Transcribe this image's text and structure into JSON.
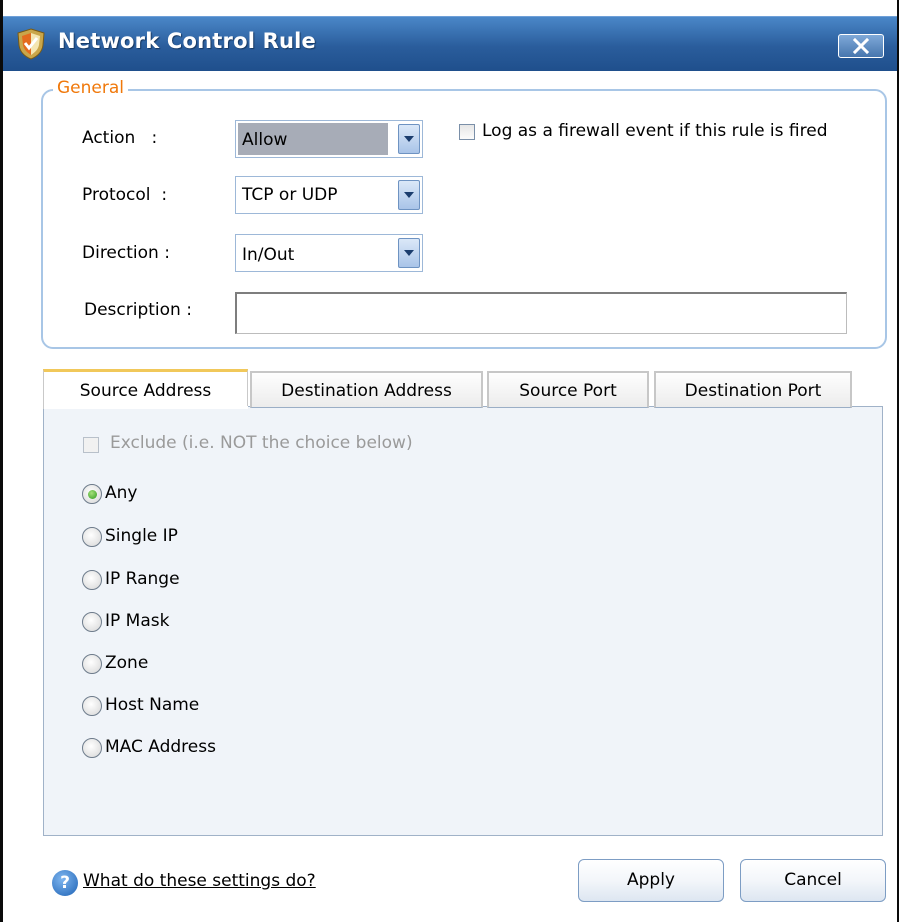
{
  "window": {
    "title": "Network Control Rule",
    "icon": "shield-icon",
    "close_icon": "close-x-icon"
  },
  "general": {
    "legend": "General",
    "action": {
      "label": "Action   :",
      "value": "Allow"
    },
    "protocol": {
      "label": "Protocol  :",
      "value": "TCP or UDP"
    },
    "direction": {
      "label": "Direction :",
      "value": "In/Out"
    },
    "description": {
      "label": "Description :",
      "value": ""
    },
    "log_checkbox": {
      "label": "Log as a firewall event if this rule is fired",
      "checked": false
    }
  },
  "tabs": [
    {
      "label": "Source Address",
      "active": true
    },
    {
      "label": "Destination Address",
      "active": false
    },
    {
      "label": "Source Port",
      "active": false
    },
    {
      "label": "Destination Port",
      "active": false
    }
  ],
  "panel": {
    "exclude": {
      "label": "Exclude (i.e. NOT the choice below)",
      "checked": false,
      "disabled": true
    },
    "options": [
      {
        "label": "Any",
        "selected": true
      },
      {
        "label": "Single IP",
        "selected": false
      },
      {
        "label": "IP Range",
        "selected": false
      },
      {
        "label": "IP Mask",
        "selected": false
      },
      {
        "label": "Zone",
        "selected": false
      },
      {
        "label": "Host Name",
        "selected": false
      },
      {
        "label": "MAC Address",
        "selected": false
      }
    ]
  },
  "footer": {
    "help_link": "What do these settings do?",
    "apply": "Apply",
    "cancel": "Cancel"
  },
  "colors": {
    "title_bar": "#2a5d9c",
    "legend": "#f0780a",
    "radio_selected": "#2f9a1e",
    "tab_active_top": "#f1c85a"
  }
}
